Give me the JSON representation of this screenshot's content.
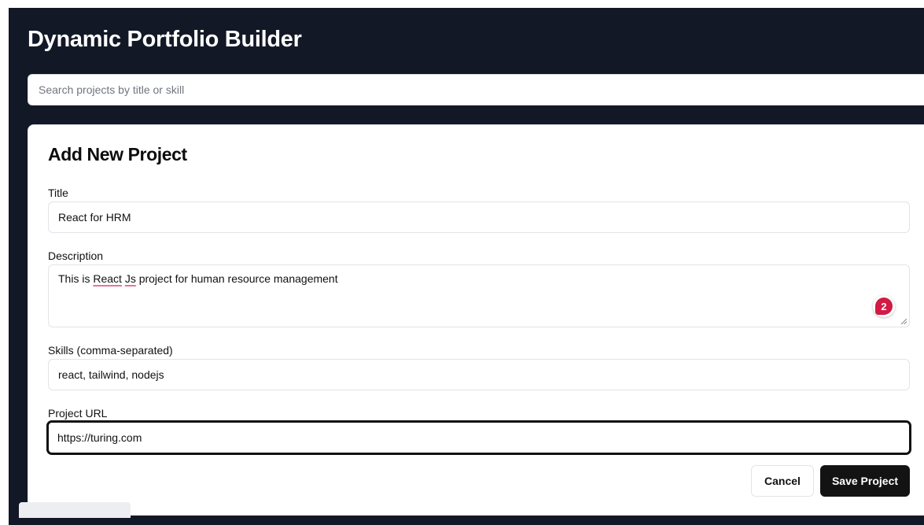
{
  "app": {
    "title": "Dynamic Portfolio Builder"
  },
  "search": {
    "placeholder": "Search projects by title or skill",
    "value": ""
  },
  "form": {
    "heading": "Add New Project",
    "title_field": {
      "label": "Title",
      "value": "React for HRM"
    },
    "description_field": {
      "label": "Description",
      "value_parts": [
        "This is ",
        "React",
        " ",
        "Js",
        " project for human resource management"
      ],
      "grammar_issue_count": "2"
    },
    "skills_field": {
      "label": "Skills (comma-separated)",
      "value": "react, tailwind, nodejs"
    },
    "url_field": {
      "label": "Project URL",
      "value": "https://turing.com"
    },
    "cancel_label": "Cancel",
    "save_label": "Save Project"
  },
  "colors": {
    "header_bg": "#131826",
    "primary_button": "#131313",
    "grammar_badge": "#d11a44"
  },
  "icons": {
    "grammar": "grammar-check-icon",
    "resize": "resize-handle-icon"
  }
}
